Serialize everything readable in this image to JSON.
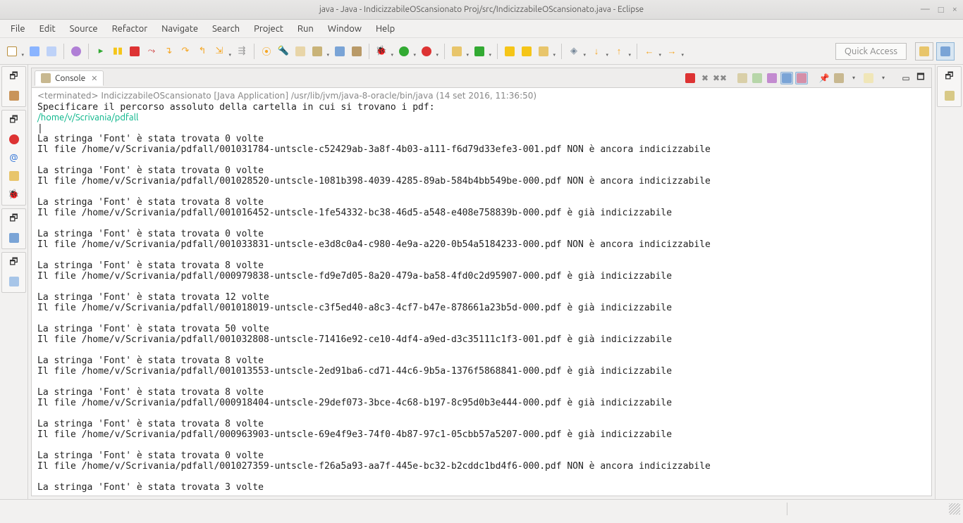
{
  "window": {
    "title": "java - Java - IndicizzabileOScansionato Proj/src/IndicizzabileOScansionato.java - Eclipse",
    "minimize": "—",
    "maximize": "□",
    "close": "×"
  },
  "menu": [
    "File",
    "Edit",
    "Source",
    "Refactor",
    "Navigate",
    "Search",
    "Project",
    "Run",
    "Window",
    "Help"
  ],
  "quick_access": "Quick Access",
  "tab": {
    "label": "Console",
    "close": "✕"
  },
  "terminated": "<terminated> IndicizzabileOScansionato [Java Application] /usr/lib/jvm/java-8-oracle/bin/java (14 set 2016, 11:36:50)",
  "output": {
    "prompt": "Specificare il percorso assoluto della cartella in cui si trovano i pdf:",
    "input_path": "/home/v/Scrivania/pdfall",
    "blocks": [
      {
        "l1": "La stringa 'Font' è stata trovata 0 volte",
        "l2": "Il file /home/v/Scrivania/pdfall/001031784-untscle-c52429ab-3a8f-4b03-a111-f6d79d33efe3-001.pdf NON è ancora indicizzabile"
      },
      {
        "l1": "La stringa 'Font' è stata trovata 0 volte",
        "l2": "Il file /home/v/Scrivania/pdfall/001028520-untscle-1081b398-4039-4285-89ab-584b4bb549be-000.pdf NON è ancora indicizzabile"
      },
      {
        "l1": "La stringa 'Font' è stata trovata 8 volte",
        "l2": "Il file /home/v/Scrivania/pdfall/001016452-untscle-1fe54332-bc38-46d5-a548-e408e758839b-000.pdf è già indicizzabile"
      },
      {
        "l1": "La stringa 'Font' è stata trovata 0 volte",
        "l2": "Il file /home/v/Scrivania/pdfall/001033831-untscle-e3d8c0a4-c980-4e9a-a220-0b54a5184233-000.pdf NON è ancora indicizzabile"
      },
      {
        "l1": "La stringa 'Font' è stata trovata 8 volte",
        "l2": "Il file /home/v/Scrivania/pdfall/000979838-untscle-fd9e7d05-8a20-479a-ba58-4fd0c2d95907-000.pdf è già indicizzabile"
      },
      {
        "l1": "La stringa 'Font' è stata trovata 12 volte",
        "l2": "Il file /home/v/Scrivania/pdfall/001018019-untscle-c3f5ed40-a8c3-4cf7-b47e-878661a23b5d-000.pdf è già indicizzabile"
      },
      {
        "l1": "La stringa 'Font' è stata trovata 50 volte",
        "l2": "Il file /home/v/Scrivania/pdfall/001032808-untscle-71416e92-ce10-4df4-a9ed-d3c35111c1f3-001.pdf è già indicizzabile"
      },
      {
        "l1": "La stringa 'Font' è stata trovata 8 volte",
        "l2": "Il file /home/v/Scrivania/pdfall/001013553-untscle-2ed91ba6-cd71-44c6-9b5a-1376f5868841-000.pdf è già indicizzabile"
      },
      {
        "l1": "La stringa 'Font' è stata trovata 8 volte",
        "l2": "Il file /home/v/Scrivania/pdfall/000918404-untscle-29def073-3bce-4c68-b197-8c95d0b3e444-000.pdf è già indicizzabile"
      },
      {
        "l1": "La stringa 'Font' è stata trovata 8 volte",
        "l2": "Il file /home/v/Scrivania/pdfall/000963903-untscle-69e4f9e3-74f0-4b87-97c1-05cbb57a5207-000.pdf è già indicizzabile"
      },
      {
        "l1": "La stringa 'Font' è stata trovata 0 volte",
        "l2": "Il file /home/v/Scrivania/pdfall/001027359-untscle-f26a5a93-aa7f-445e-bc32-b2cddc1bd4f6-000.pdf NON è ancora indicizzabile"
      }
    ],
    "partial": "La stringa 'Font' è stata trovata 3 volte"
  }
}
